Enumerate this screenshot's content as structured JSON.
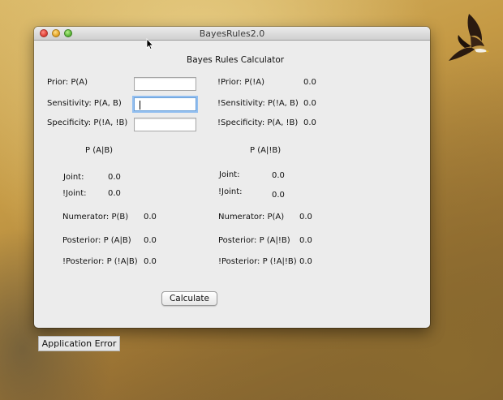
{
  "window": {
    "title": "BayesRules2.0",
    "heading": "Bayes Rules Calculator"
  },
  "inputs": {
    "prior_label": "Prior: P(A)",
    "prior_value": "",
    "sensitivity_label": "Sensitivity: P(A, B)",
    "sensitivity_value": "",
    "specificity_label": "Specificity: P(!A, !B)",
    "specificity_value": ""
  },
  "complements": {
    "not_prior_label": "!Prior: P(!A)",
    "not_prior_value": "0.0",
    "not_sensitivity_label": "!Sensitivity: P(!A, B)",
    "not_sensitivity_value": "0.0",
    "not_specificity_label": "!Specificity: P(A, !B)",
    "not_specificity_value": "0.0"
  },
  "left_column": {
    "header": "P (A|B)",
    "joint_label": "Joint:",
    "joint_value": "0.0",
    "not_joint_label": "!Joint:",
    "not_joint_value": "0.0",
    "numerator_label": "Numerator: P(B)",
    "numerator_value": "0.0",
    "posterior_label": "Posterior: P (A|B)",
    "posterior_value": "0.0",
    "not_posterior_label": "!Posterior: P (!A|B)",
    "not_posterior_value": "0.0"
  },
  "right_column": {
    "header": "P (A|!B)",
    "joint_label": "Joint:",
    "joint_value": "0.0",
    "not_joint_label": "!Joint:",
    "not_joint_value": "0.0",
    "numerator_label": "Numerator: P(A)",
    "numerator_value": "0.0",
    "posterior_label": "Posterior: P (A|!B)",
    "posterior_value": "0.0",
    "not_posterior_label": "!Posterior: P (!A|!B)",
    "not_posterior_value": "0.0"
  },
  "buttons": {
    "calculate_label": "Calculate",
    "application_error_label": "Application Error"
  },
  "icons": {
    "close": "close-icon",
    "minimize": "minimize-icon",
    "maximize": "maximize-icon",
    "eagle": "eagle-icon",
    "cursor": "mouse-cursor-icon"
  },
  "colors": {
    "window_bg": "#ececec",
    "focus_ring": "#93bff0",
    "close": "#e0443a",
    "minimize": "#e7a628",
    "maximize": "#5fb93b"
  }
}
